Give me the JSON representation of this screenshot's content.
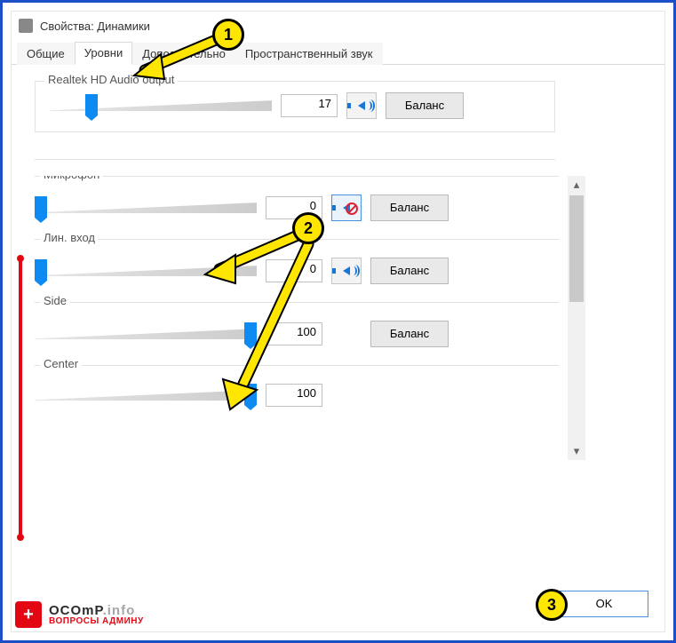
{
  "window": {
    "title": "Свойства: Динамики"
  },
  "tabs": [
    {
      "label": "Общие"
    },
    {
      "label": "Уровни"
    },
    {
      "label": "Дополнительно"
    },
    {
      "label": "Пространственный звук"
    }
  ],
  "active_tab": 1,
  "main_output": {
    "name": "Realtek HD Audio output",
    "value": "17",
    "slider_pct": 17,
    "muted": false,
    "balance_label": "Баланс"
  },
  "inputs": [
    {
      "name": "Микрофон",
      "value": "0",
      "slider_pct": 0,
      "muted": true,
      "balance_label": "Баланс",
      "show_icon": true
    },
    {
      "name": "Лин. вход",
      "value": "0",
      "slider_pct": 0,
      "muted": false,
      "balance_label": "Баланс",
      "show_icon": true
    },
    {
      "name": "Side",
      "value": "100",
      "slider_pct": 100,
      "muted": false,
      "balance_label": "Баланс",
      "show_icon": false
    },
    {
      "name": "Center",
      "value": "100",
      "slider_pct": 100,
      "muted": false,
      "balance_label": "",
      "show_icon": false
    }
  ],
  "ok_label": "OK",
  "annotations": {
    "c1": "1",
    "c2": "2",
    "c3": "3"
  },
  "watermark": {
    "badge": "+",
    "brand": "OCOmP",
    "suffix": ".info",
    "tag": "ВОПРОСЫ АДМИНУ"
  }
}
